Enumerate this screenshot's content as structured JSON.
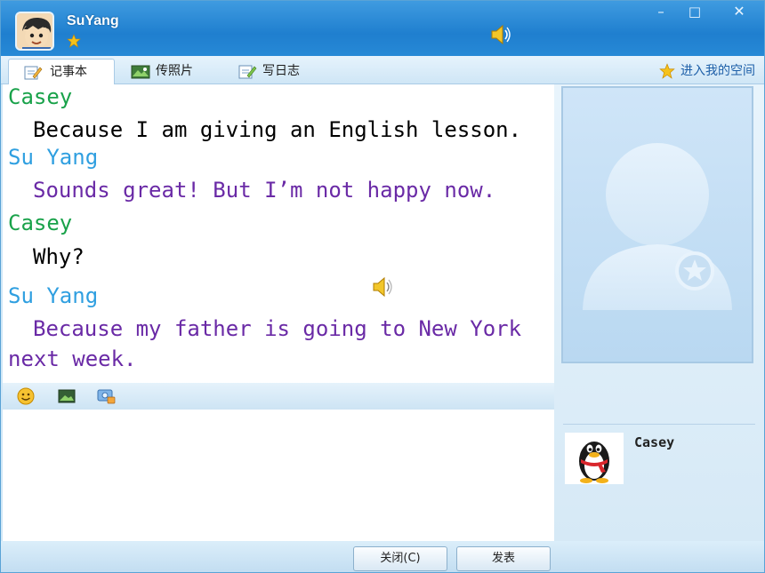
{
  "window": {
    "username": "SuYang",
    "controls": {
      "minimize": "–",
      "maximize": "□",
      "close": "✕"
    }
  },
  "tabs": [
    {
      "label": "记事本",
      "icon": "notepad-icon",
      "active": true
    },
    {
      "label": "传照片",
      "icon": "photo-icon",
      "active": false
    },
    {
      "label": "写日志",
      "icon": "diary-icon",
      "active": false
    }
  ],
  "space_link": {
    "label": "进入我的空间",
    "icon": "star-icon"
  },
  "messages": [
    {
      "sender": "Casey",
      "text": "Because I am giving an English lesson."
    },
    {
      "sender": "Su Yang",
      "text": "Sounds great! But I’m not happy now."
    },
    {
      "sender": "Casey",
      "text": "Why?"
    },
    {
      "sender": "Su Yang",
      "text_line1": "Because my father is going to New York",
      "text_line2": "next week."
    }
  ],
  "toolbar": {
    "icons": [
      "smiley-icon",
      "image-icon",
      "screenshot-icon"
    ]
  },
  "buttons": {
    "close": "关闭(C)",
    "send": "发表"
  },
  "contact": {
    "name": "Casey"
  },
  "colors": {
    "casey_name": "#19a24a",
    "suyang_name": "#2f9fe0",
    "casey_text": "#000000",
    "suyang_text": "#6a2aa6",
    "titlebar": "#1f7fcf"
  }
}
